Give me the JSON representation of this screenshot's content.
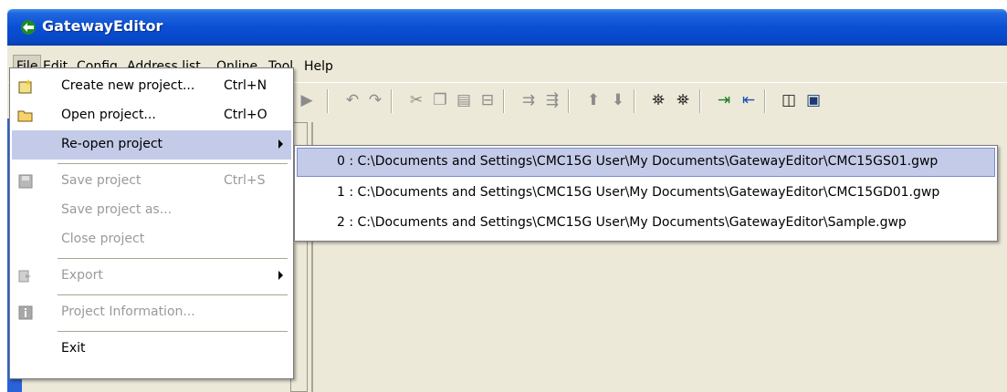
{
  "window": {
    "title": "GatewayEditor"
  },
  "menubar": {
    "items": [
      "File",
      "Edit",
      "Config",
      "Address list",
      "Online",
      "Tool",
      "Help"
    ]
  },
  "file_menu": {
    "items": [
      {
        "label": "Create new project...",
        "shortcut": "Ctrl+N",
        "icon": "new-project-icon",
        "enabled": true
      },
      {
        "label": "Open project...",
        "shortcut": "Ctrl+O",
        "icon": "folder-icon",
        "enabled": true
      },
      {
        "label": "Re-open project",
        "shortcut": "",
        "icon": "",
        "enabled": true,
        "submenu": true,
        "highlighted": true
      },
      {
        "label": "Save project",
        "shortcut": "Ctrl+S",
        "icon": "save-icon",
        "enabled": false
      },
      {
        "label": "Save project as...",
        "shortcut": "",
        "icon": "",
        "enabled": false
      },
      {
        "label": "Close project",
        "shortcut": "",
        "icon": "",
        "enabled": false
      },
      {
        "label": "Export",
        "shortcut": "",
        "icon": "export-icon",
        "enabled": false,
        "submenu": true
      },
      {
        "label": "Project Information...",
        "shortcut": "",
        "icon": "info-icon",
        "enabled": false
      },
      {
        "label": "Exit",
        "shortcut": "",
        "icon": "",
        "enabled": true
      }
    ]
  },
  "reopen_submenu": {
    "items": [
      "0 : C:\\Documents and Settings\\CMC15G User\\My Documents\\GatewayEditor\\CMC15GS01.gwp",
      "1 : C:\\Documents and Settings\\CMC15G User\\My Documents\\GatewayEditor\\CMC15GD01.gwp",
      "2 : C:\\Documents and Settings\\CMC15G User\\My Documents\\GatewayEditor\\Sample.gwp"
    ]
  },
  "toolbar": {
    "icons": [
      "play-icon",
      "undo-icon",
      "redo-icon",
      "cut-icon",
      "copy-icon",
      "paste-icon",
      "delete-icon",
      "insert-row-icon",
      "delete-row-icon",
      "move-up-icon",
      "move-down-icon",
      "find-icon",
      "find-next-icon",
      "import-icon",
      "export-icon",
      "compare-icon",
      "monitor-icon"
    ]
  },
  "colors": {
    "titlebar": "#0a4fd4",
    "menu_highlight": "#c4cbe8",
    "frame": "#ece9d8"
  }
}
